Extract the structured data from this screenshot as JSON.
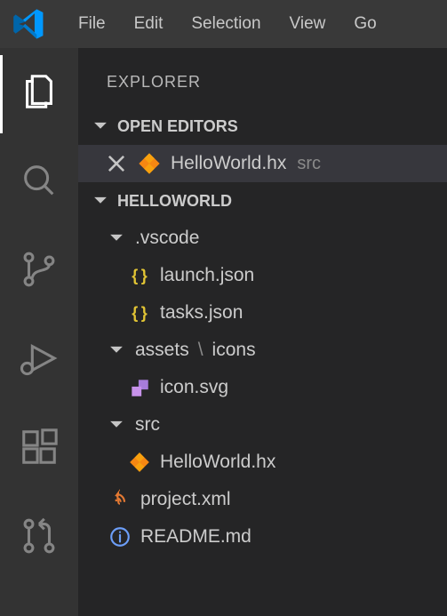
{
  "menubar": {
    "items": [
      "File",
      "Edit",
      "Selection",
      "View",
      "Go"
    ]
  },
  "sidebar": {
    "title": "EXPLORER",
    "open_editors": {
      "label": "OPEN EDITORS",
      "entries": [
        {
          "name": "HelloWorld.hx",
          "path": "src"
        }
      ]
    },
    "workspace": {
      "label": "HELLOWORLD",
      "tree": [
        {
          "type": "folder",
          "label": ".vscode"
        },
        {
          "type": "file",
          "label": "launch.json",
          "icon": "json"
        },
        {
          "type": "file",
          "label": "tasks.json",
          "icon": "json"
        },
        {
          "type": "folder",
          "label": "assets",
          "trail": "icons"
        },
        {
          "type": "file",
          "label": "icon.svg",
          "icon": "svg"
        },
        {
          "type": "folder",
          "label": "src"
        },
        {
          "type": "file",
          "label": "HelloWorld.hx",
          "icon": "haxe",
          "root": true
        },
        {
          "type": "file",
          "label": "project.xml",
          "icon": "xml",
          "root": true
        },
        {
          "type": "file",
          "label": "README.md",
          "icon": "info",
          "root": true
        }
      ]
    }
  }
}
